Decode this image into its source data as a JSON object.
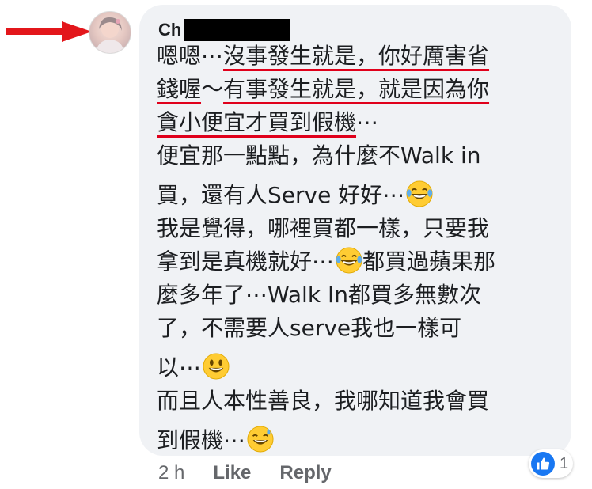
{
  "comment": {
    "author_name": "Ch",
    "body_lines": [
      {
        "parts": [
          {
            "text": "嗯嗯⋯",
            "u": false
          },
          {
            "text": "沒事發生就是，你好厲害省",
            "u": true
          }
        ]
      },
      {
        "parts": [
          {
            "text": "錢喔",
            "u": true
          },
          {
            "text": "～",
            "u": false
          },
          {
            "text": "有事發生就是，就是因為你",
            "u": true
          }
        ]
      },
      {
        "parts": [
          {
            "text": "貪小便宜才買到假機",
            "u": true
          },
          {
            "text": "⋯",
            "u": false
          }
        ]
      },
      {
        "parts": [
          {
            "text": "便宜那一點點，為什麼不Walk in",
            "u": false
          }
        ]
      },
      {
        "parts": [
          {
            "text": "買，還有人Serve 好好⋯",
            "u": false
          }
        ],
        "emoji": "laughing-tears",
        "gap": true
      },
      {
        "parts": [
          {
            "text": "我是覺得，哪裡買都一樣，只要我",
            "u": false
          }
        ]
      },
      {
        "parts": [
          {
            "text": "拿到是真機就好⋯",
            "u": false
          },
          {
            "text": "都買過蘋果那",
            "u": false
          }
        ],
        "inline_emoji": "laughing-tears"
      },
      {
        "parts": [
          {
            "text": "麼多年了⋯Walk In都買多無數次",
            "u": false
          }
        ]
      },
      {
        "parts": [
          {
            "text": "了，不需要人serve我也一樣可",
            "u": false
          }
        ]
      },
      {
        "parts": [
          {
            "text": "以⋯",
            "u": false
          }
        ],
        "emoji": "smiley",
        "gap": true
      },
      {
        "parts": [
          {
            "text": "而且人本性善良，我哪知道我會買",
            "u": false
          }
        ]
      },
      {
        "parts": [
          {
            "text": "到假機⋯",
            "u": false
          }
        ],
        "emoji": "sweat-smile",
        "gap": true
      }
    ]
  },
  "reaction": {
    "icon": "thumbs-up-icon",
    "count": "1",
    "color": "#1877f2"
  },
  "footer": {
    "time": "2 h",
    "like_label": "Like",
    "reply_label": "Reply"
  },
  "colors": {
    "bubble": "#f0f2f5",
    "underline": "#e0001b",
    "arrow": "#e3161b",
    "muted": "#65676b"
  }
}
